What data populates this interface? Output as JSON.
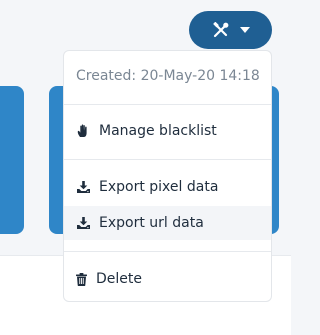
{
  "toolbar": {
    "button_icon": "tools-icon",
    "caret_icon": "caret-down-icon"
  },
  "menu": {
    "header": "Created: 20-May-20 14:18",
    "items": [
      {
        "label": "Manage blacklist",
        "icon": "hand-icon"
      },
      {
        "label": "Export pixel data",
        "icon": "download-icon"
      },
      {
        "label": "Export url data",
        "icon": "download-icon"
      },
      {
        "label": "Delete",
        "icon": "trash-icon"
      }
    ]
  },
  "colors": {
    "accent_dark": "#1f5f93",
    "card_blue": "#2f86c8",
    "hover_bg": "#f3f5f8"
  }
}
